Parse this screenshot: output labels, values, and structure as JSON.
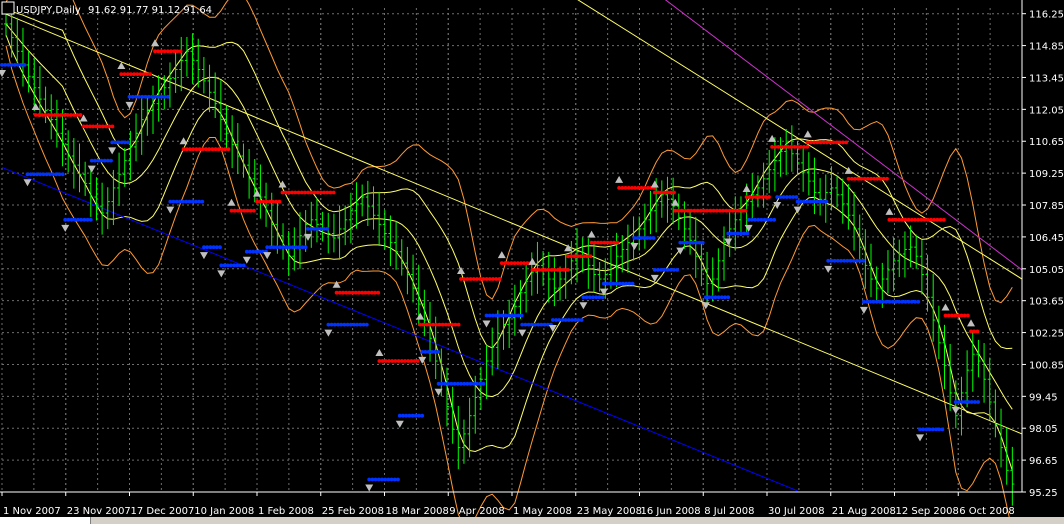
{
  "header": {
    "symbol": "USDJPY,Daily",
    "ohlc": "91.62 91.77 91.12 91.64"
  },
  "colors": {
    "background": "#000000",
    "grid": "#6e6e6e",
    "bars": "#00ff00",
    "resistance_dots": "#ff0000",
    "support_dots": "#0033ff",
    "bollinger_inner": "#ffff66",
    "bollinger_outer": "#ff9933",
    "channel_yellow": "#ffff66",
    "channel_blue": "#0000ff",
    "channel_magenta": "#cc33cc",
    "fractal_arrows": "#c0c0c0",
    "axis_text": "#ffffff"
  },
  "chart_data": {
    "type": "line",
    "title": "USDJPY,Daily 91.62 91.77 91.12 91.64",
    "xlabel": "",
    "ylabel": "",
    "ylim": [
      95.25,
      116.5
    ],
    "y_ticks": [
      "116.25",
      "114.85",
      "113.45",
      "112.05",
      "110.65",
      "109.25",
      "107.85",
      "106.45",
      "105.05",
      "103.65",
      "102.25",
      "100.85",
      "99.45",
      "98.05",
      "96.65",
      "95.25"
    ],
    "x_ticks": [
      "1 Nov 2007",
      "23 Nov 2007",
      "17 Dec 2007",
      "10 Jan 2008",
      "1 Feb 2008",
      "25 Feb 2008",
      "18 Mar 2008",
      "9 Apr 2008",
      "1 May 2008",
      "23 May 2008",
      "16 Jun 2008",
      "8 Jul 2008",
      "30 Jul 2008",
      "21 Aug 2008",
      "12 Sep 2008",
      "6 Oct 2008"
    ],
    "grid": true,
    "series": [
      {
        "values": [
          115.8,
          115.2,
          114.6,
          114.0,
          113.5,
          113.0,
          112.5,
          112.0,
          111.6,
          111.0,
          110.5,
          110.0,
          109.6,
          109.2,
          108.8,
          108.2,
          107.8,
          107.5,
          108.0,
          108.6,
          109.2,
          109.8,
          110.4,
          111.0,
          111.6,
          112.0,
          112.3,
          112.6,
          113.0,
          113.4,
          113.8,
          114.2,
          114.6,
          114.2,
          113.8,
          113.3,
          112.8,
          112.3,
          111.6,
          111.0,
          110.5,
          110.0,
          109.6,
          109.0,
          108.6,
          108.2,
          107.6,
          107.0,
          106.5,
          106.0,
          105.6,
          106.0,
          106.5,
          107.0,
          107.2,
          107.0,
          106.8,
          106.6,
          106.4,
          106.8,
          107.2,
          107.6,
          107.9,
          108.2,
          107.8,
          107.4,
          107.0,
          106.6,
          106.2,
          105.8,
          105.3,
          104.8,
          104.2,
          103.5,
          102.8,
          102.0,
          101.0,
          100.0,
          99.0,
          98.0,
          97.2,
          97.8,
          98.6,
          99.4,
          100.2,
          101.0,
          101.6,
          102.2,
          102.6,
          102.9,
          103.4,
          104.0,
          104.5,
          104.9,
          105.2,
          105.0,
          104.6,
          104.2,
          104.6,
          105.0,
          105.4,
          105.8,
          105.6,
          105.2,
          104.8,
          104.6,
          104.8,
          105.2,
          105.6,
          105.9,
          106.2,
          106.4,
          106.8,
          107.2,
          107.6,
          108.0,
          108.3,
          108.1,
          107.8,
          107.3,
          106.8,
          106.3,
          105.6,
          105.0,
          104.4,
          104.6,
          105.4,
          106.2,
          106.8,
          107.2,
          107.6,
          108.0,
          108.3,
          108.6,
          109.0,
          109.4,
          109.8,
          110.2,
          110.4,
          110.1,
          109.7,
          109.3,
          108.9,
          108.4,
          108.1,
          108.4,
          108.6,
          108.3,
          107.9,
          107.4,
          106.8,
          106.0,
          105.2,
          104.6,
          104.2,
          104.6,
          105.0,
          105.4,
          105.7,
          105.9,
          106.0,
          105.6,
          104.8,
          103.8,
          102.8,
          101.8,
          100.8,
          99.6,
          98.6,
          99.6,
          100.6,
          101.3,
          101.0,
          100.2,
          99.2,
          98.2,
          97.2,
          96.2,
          95.6
        ]
      }
    ],
    "resistance_levels": [
      {
        "from": 0.033,
        "to": 0.078,
        "value": 111.8
      },
      {
        "from": 0.08,
        "to": 0.11,
        "value": 111.3
      },
      {
        "from": 0.117,
        "to": 0.148,
        "value": 113.6
      },
      {
        "from": 0.15,
        "to": 0.178,
        "value": 114.6
      },
      {
        "from": 0.178,
        "to": 0.225,
        "value": 110.3
      },
      {
        "from": 0.225,
        "to": 0.25,
        "value": 107.6
      },
      {
        "from": 0.25,
        "to": 0.275,
        "value": 108.0
      },
      {
        "from": 0.275,
        "to": 0.328,
        "value": 108.4
      },
      {
        "from": 0.328,
        "to": 0.37,
        "value": 104.0
      },
      {
        "from": 0.37,
        "to": 0.41,
        "value": 101.0
      },
      {
        "from": 0.41,
        "to": 0.45,
        "value": 102.6
      },
      {
        "from": 0.45,
        "to": 0.49,
        "value": 104.6
      },
      {
        "from": 0.49,
        "to": 0.52,
        "value": 105.3
      },
      {
        "from": 0.52,
        "to": 0.555,
        "value": 105.0
      },
      {
        "from": 0.555,
        "to": 0.578,
        "value": 105.6
      },
      {
        "from": 0.578,
        "to": 0.605,
        "value": 106.2
      },
      {
        "from": 0.605,
        "to": 0.64,
        "value": 108.6
      },
      {
        "from": 0.64,
        "to": 0.66,
        "value": 108.4
      },
      {
        "from": 0.66,
        "to": 0.73,
        "value": 107.6
      },
      {
        "from": 0.73,
        "to": 0.755,
        "value": 108.2
      },
      {
        "from": 0.755,
        "to": 0.79,
        "value": 110.4
      },
      {
        "from": 0.79,
        "to": 0.83,
        "value": 110.6
      },
      {
        "from": 0.83,
        "to": 0.87,
        "value": 109.0
      },
      {
        "from": 0.87,
        "to": 0.925,
        "value": 107.2
      },
      {
        "from": 0.925,
        "to": 0.95,
        "value": 103.0
      },
      {
        "from": 0.95,
        "to": 0.958,
        "value": 102.3
      }
    ],
    "support_levels": [
      {
        "from": 0.0,
        "to": 0.025,
        "value": 114.0
      },
      {
        "from": 0.025,
        "to": 0.062,
        "value": 109.2
      },
      {
        "from": 0.062,
        "to": 0.088,
        "value": 107.2
      },
      {
        "from": 0.088,
        "to": 0.108,
        "value": 109.8
      },
      {
        "from": 0.108,
        "to": 0.125,
        "value": 110.6
      },
      {
        "from": 0.125,
        "to": 0.165,
        "value": 112.6
      },
      {
        "from": 0.165,
        "to": 0.198,
        "value": 108.0
      },
      {
        "from": 0.198,
        "to": 0.215,
        "value": 106.0
      },
      {
        "from": 0.215,
        "to": 0.24,
        "value": 105.2
      },
      {
        "from": 0.24,
        "to": 0.26,
        "value": 105.8
      },
      {
        "from": 0.26,
        "to": 0.3,
        "value": 106.0
      },
      {
        "from": 0.3,
        "to": 0.32,
        "value": 106.8
      },
      {
        "from": 0.32,
        "to": 0.36,
        "value": 102.6
      },
      {
        "from": 0.36,
        "to": 0.39,
        "value": 95.8
      },
      {
        "from": 0.39,
        "to": 0.412,
        "value": 98.6
      },
      {
        "from": 0.412,
        "to": 0.428,
        "value": 101.4
      },
      {
        "from": 0.428,
        "to": 0.475,
        "value": 100.0
      },
      {
        "from": 0.475,
        "to": 0.51,
        "value": 103.0
      },
      {
        "from": 0.51,
        "to": 0.54,
        "value": 102.6
      },
      {
        "from": 0.54,
        "to": 0.57,
        "value": 102.8
      },
      {
        "from": 0.57,
        "to": 0.59,
        "value": 103.8
      },
      {
        "from": 0.59,
        "to": 0.62,
        "value": 104.4
      },
      {
        "from": 0.62,
        "to": 0.64,
        "value": 106.4
      },
      {
        "from": 0.64,
        "to": 0.665,
        "value": 105.0
      },
      {
        "from": 0.665,
        "to": 0.69,
        "value": 106.2
      },
      {
        "from": 0.69,
        "to": 0.712,
        "value": 103.8
      },
      {
        "from": 0.712,
        "to": 0.732,
        "value": 106.6
      },
      {
        "from": 0.732,
        "to": 0.76,
        "value": 107.2
      },
      {
        "from": 0.76,
        "to": 0.78,
        "value": 108.2
      },
      {
        "from": 0.78,
        "to": 0.81,
        "value": 108.0
      },
      {
        "from": 0.81,
        "to": 0.845,
        "value": 105.4
      },
      {
        "from": 0.845,
        "to": 0.9,
        "value": 103.6
      },
      {
        "from": 0.9,
        "to": 0.925,
        "value": 98.0
      },
      {
        "from": 0.935,
        "to": 0.958,
        "value": 99.2
      }
    ],
    "trend_lines": [
      {
        "name": "",
        "color_key": "channel_yellow",
        "x1": 0.0,
        "y1": 116.3,
        "x2": 1.0,
        "y2": 97.8
      },
      {
        "name": "",
        "color_key": "channel_blue",
        "x1": 0.0,
        "y1": 109.5,
        "x2": 0.78,
        "y2": 95.3
      },
      {
        "name": "",
        "color_key": "channel_magenta",
        "x1": 0.44,
        "y1": 124.0,
        "x2": 1.0,
        "y2": 105.0
      },
      {
        "name": "",
        "color_key": "channel_yellow",
        "x1": 0.24,
        "y1": 126.0,
        "x2": 1.0,
        "y2": 104.6
      }
    ]
  }
}
